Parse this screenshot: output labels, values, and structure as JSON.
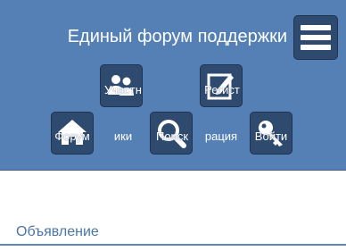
{
  "header": {
    "site_title": "Единый форум поддержки",
    "menu_icon": "hamburger-menu-icon",
    "background": "#5480b6"
  },
  "nav": {
    "members": {
      "label_line1": "Участн",
      "label_line2": "ики",
      "icon": "users-icon"
    },
    "register": {
      "label_line1": "Регист",
      "label_line2": "рация",
      "icon": "edit-icon"
    },
    "forum": {
      "label": "Форум",
      "icon": "home-icon"
    },
    "search": {
      "label": "Поиск",
      "icon": "search-icon"
    },
    "login": {
      "label": "Войти",
      "icon": "key-icon"
    }
  },
  "content": {
    "section_title": "Объявление"
  },
  "colors": {
    "icon_tile": "#2e4a6e",
    "section_text": "#4a76a8"
  }
}
